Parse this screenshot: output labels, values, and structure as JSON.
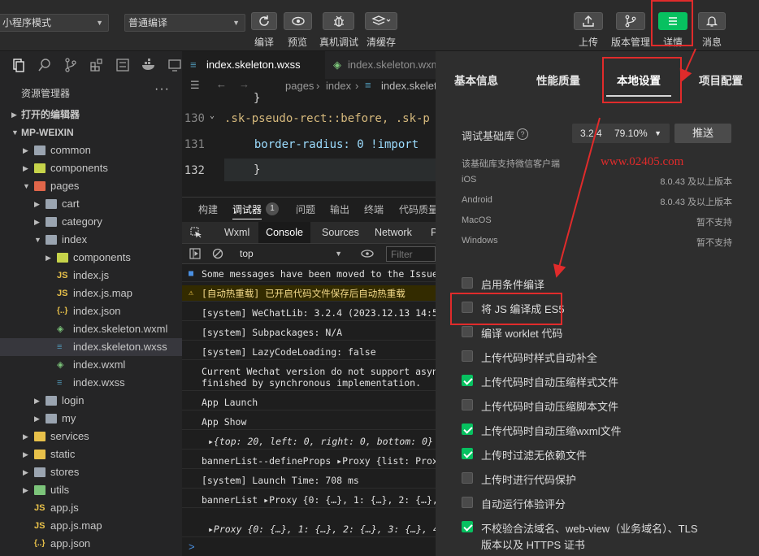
{
  "toolbar": {
    "mode_select": "小程序模式",
    "compile_select": "普通编译",
    "left_buttons": [
      {
        "label": "编译",
        "icon": "refresh-icon"
      },
      {
        "label": "预览",
        "icon": "eye-icon"
      },
      {
        "label": "真机调试",
        "icon": "bug-icon"
      },
      {
        "label": "清缓存",
        "icon": "layers-icon"
      }
    ],
    "right_buttons": [
      {
        "label": "上传",
        "icon": "upload-icon"
      },
      {
        "label": "版本管理",
        "icon": "branch-icon"
      },
      {
        "label": "详情",
        "icon": "menu-icon"
      },
      {
        "label": "消息",
        "icon": "bell-icon"
      }
    ]
  },
  "explorer": {
    "title": "资源管理器",
    "more": "···",
    "open_editors": "打开的编辑器",
    "project": "MP-WEIXIN",
    "items": [
      {
        "label": "common",
        "kind": "folder",
        "depth": 1,
        "expanded": false,
        "color": "#9aa4b0"
      },
      {
        "label": "components",
        "kind": "folder",
        "depth": 1,
        "expanded": false,
        "color": "#c6d34a"
      },
      {
        "label": "pages",
        "kind": "folder",
        "depth": 1,
        "expanded": true,
        "color": "#e0664a"
      },
      {
        "label": "cart",
        "kind": "folder",
        "depth": 2,
        "expanded": false,
        "color": "#9aa4b0"
      },
      {
        "label": "category",
        "kind": "folder",
        "depth": 2,
        "expanded": false,
        "color": "#9aa4b0"
      },
      {
        "label": "index",
        "kind": "folder",
        "depth": 2,
        "expanded": true,
        "color": "#9aa4b0"
      },
      {
        "label": "components",
        "kind": "folder",
        "depth": 3,
        "expanded": false,
        "color": "#c6d34a"
      },
      {
        "label": "index.js",
        "kind": "js",
        "depth": 3
      },
      {
        "label": "index.js.map",
        "kind": "js",
        "depth": 3
      },
      {
        "label": "index.json",
        "kind": "json",
        "depth": 3
      },
      {
        "label": "index.skeleton.wxml",
        "kind": "wxml",
        "depth": 3
      },
      {
        "label": "index.skeleton.wxss",
        "kind": "wxss",
        "depth": 3,
        "selected": true
      },
      {
        "label": "index.wxml",
        "kind": "wxml",
        "depth": 3
      },
      {
        "label": "index.wxss",
        "kind": "wxss",
        "depth": 3
      },
      {
        "label": "login",
        "kind": "folder",
        "depth": 2,
        "expanded": false,
        "color": "#9aa4b0"
      },
      {
        "label": "my",
        "kind": "folder",
        "depth": 2,
        "expanded": false,
        "color": "#9aa4b0"
      },
      {
        "label": "services",
        "kind": "folder",
        "depth": 1,
        "expanded": false,
        "color": "#e8c14a"
      },
      {
        "label": "static",
        "kind": "folder",
        "depth": 1,
        "expanded": false,
        "color": "#e8c14a"
      },
      {
        "label": "stores",
        "kind": "folder",
        "depth": 1,
        "expanded": false,
        "color": "#9aa4b0"
      },
      {
        "label": "utils",
        "kind": "folder",
        "depth": 1,
        "expanded": false,
        "color": "#7cc47a"
      },
      {
        "label": "app.js",
        "kind": "js",
        "depth": 1
      },
      {
        "label": "app.js.map",
        "kind": "js",
        "depth": 1
      },
      {
        "label": "app.json",
        "kind": "json",
        "depth": 1
      }
    ]
  },
  "editor": {
    "tabs": [
      {
        "label": "index.skeleton.wxss",
        "active": true
      },
      {
        "label": "index.skeleton.wxm",
        "active": false
      }
    ],
    "breadcrumb": [
      "pages",
      "index",
      "index.skelet"
    ],
    "lines": [
      {
        "num": "",
        "text": "}",
        "color": "#d4d4d4"
      },
      {
        "num": "130",
        "text": ".sk-pseudo-rect::before, .sk-p",
        "color": "#d7ba7d"
      },
      {
        "num": "131",
        "text": "  border-radius: 0 !import",
        "color": "#9cdcfe"
      },
      {
        "num": "132",
        "text": "}",
        "color": "#d4d4d4"
      }
    ]
  },
  "panel": {
    "tabs": [
      "构建",
      "调试器",
      "问题",
      "输出",
      "终端",
      "代码质量"
    ],
    "debugger_badge": "1",
    "devtools_tabs": [
      "Wxml",
      "Console",
      "Sources",
      "Network",
      "P"
    ],
    "context": "top",
    "filter_placeholder": "Filter",
    "console": [
      {
        "text": "Some messages have been moved to the Issues",
        "kind": "info"
      },
      {
        "text": "[自动热重载] 已开启代码文件保存后自动热重载",
        "kind": "warn"
      },
      {
        "text": "[system] WeChatLib: 3.2.4 (2023.12.13 14:51:",
        "kind": "log"
      },
      {
        "text": "[system] Subpackages: N/A",
        "kind": "log"
      },
      {
        "text": "[system] LazyCodeLoading: false",
        "kind": "log"
      },
      {
        "text": "Current Wechat version do not support asynch\nfinished by synchronous implementation.",
        "kind": "log"
      },
      {
        "text": "App Launch",
        "kind": "log"
      },
      {
        "text": "App Show",
        "kind": "log"
      },
      {
        "text": "▸{top: 20, left: 0, right: 0, bottom: 0}",
        "kind": "obj"
      },
      {
        "text": "bannerList--defineProps ▸Proxy {list: Proxy",
        "kind": "log"
      },
      {
        "text": "[system] Launch Time: 708 ms",
        "kind": "log"
      },
      {
        "text": "bannerList ▸Proxy {0: {…}, 1: {…}, 2: {…},",
        "kind": "log"
      },
      {
        "text": "▸Proxy {0: {…}, 1: {…}, 2: {…}, 3: {…}, 4:",
        "kind": "obj"
      }
    ],
    "prompt": ">"
  },
  "details": {
    "tabs": [
      "基本信息",
      "性能质量",
      "本地设置",
      "项目配置"
    ],
    "active_tab": "本地设置",
    "debug_lib_label": "调试基础库",
    "debug_lib_version": "3.2.4",
    "debug_lib_percent": "79.10%",
    "push_label": "推送",
    "support_note": "该基础库支持微信客户端",
    "watermark": "www.02405.com",
    "platforms": [
      {
        "name": "iOS",
        "value": "8.0.43 及以上版本"
      },
      {
        "name": "Android",
        "value": "8.0.43 及以上版本"
      },
      {
        "name": "MacOS",
        "value": "暂不支持"
      },
      {
        "name": "Windows",
        "value": "暂不支持"
      }
    ],
    "options": [
      {
        "label": "启用条件编译",
        "checked": false
      },
      {
        "label": "将 JS 编译成 ES5",
        "checked": false
      },
      {
        "label": "编译 worklet 代码",
        "checked": false
      },
      {
        "label": "上传代码时样式自动补全",
        "checked": false
      },
      {
        "label": "上传代码时自动压缩样式文件",
        "checked": true
      },
      {
        "label": "上传代码时自动压缩脚本文件",
        "checked": false
      },
      {
        "label": "上传代码时自动压缩wxml文件",
        "checked": true
      },
      {
        "label": "上传时过滤无依赖文件",
        "checked": true
      },
      {
        "label": "上传时进行代码保护",
        "checked": false
      },
      {
        "label": "自动运行体验评分",
        "checked": false
      },
      {
        "label": "不校验合法域名、web-view（业务域名）、TLS",
        "label2": "版本以及 HTTPS 证书",
        "checked": true
      }
    ]
  },
  "colors": {
    "accent_green": "#07c160",
    "annotation_red": "#e02b2b"
  }
}
